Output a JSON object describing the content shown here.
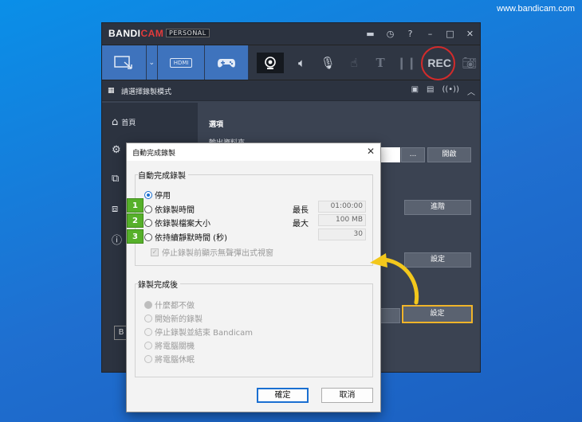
{
  "watermark": "www.bandicam.com",
  "app": {
    "logo_main": "BANDI",
    "logo_accent": "CAM",
    "edition": "PERSONAL",
    "rec_label": "REC",
    "hdmi_label": "HDMI",
    "mode_label": "請選擇錄製模式",
    "sidebar": {
      "home": "首頁"
    },
    "section_title": "選項",
    "output_label": "輸出資料夾",
    "browse_label": "...",
    "open_label": "開啟",
    "advanced_label": "進階",
    "settings_label": "設定",
    "settings2_label": "設定",
    "side_b": "B"
  },
  "dialog": {
    "title": "自動完成錄製",
    "group1_label": "自動完成錄製",
    "opt_disable": "停用",
    "opt_time": "依錄製時間",
    "opt_size": "依錄製檔案大小",
    "opt_silence": "依持續靜默時間 (秒)",
    "limit_time_label": "最長",
    "limit_time_value": "01:00:00",
    "limit_size_label": "最大",
    "limit_size_value": "100 MB",
    "silence_value": "30",
    "popup_check": "停止錄製前顯示無聲彈出式視窗",
    "group2_label": "錄製完成後",
    "after_nothing": "什麼都不做",
    "after_new": "開始新的錄製",
    "after_exit": "停止錄製並結束 Bandicam",
    "after_shutdown": "將電腦關機",
    "after_sleep": "將電腦休眠",
    "ok": "確定",
    "cancel": "取消"
  },
  "badges": [
    "1",
    "2",
    "3"
  ],
  "colors": {
    "accent": "#3e73bd",
    "rec_ring": "#d32b2b",
    "badge": "#56b02a",
    "highlight": "#f0b42a"
  }
}
